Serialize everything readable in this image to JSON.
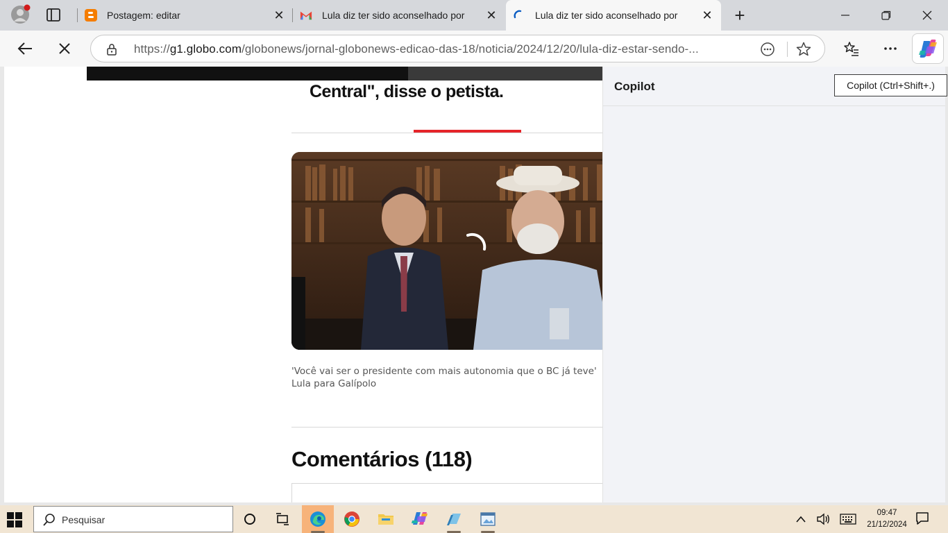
{
  "browser": {
    "tabs": [
      {
        "title": "Postagem: editar",
        "favicon": "blogger-icon",
        "active": false
      },
      {
        "title": "Lula diz ter sido aconselhado por",
        "favicon": "gmail-icon",
        "active": false
      },
      {
        "title": "Lula diz ter sido aconselhado por",
        "favicon": "loading-spinner-icon",
        "active": true
      }
    ],
    "new_tab_symbol": "+",
    "address": {
      "scheme": "https://",
      "host": "g1.globo.com",
      "path": "/globonews/jornal-globonews-edicao-das-18/noticia/2024/12/20/lula-diz-estar-sendo-..."
    }
  },
  "page": {
    "quote_end": "Central\", disse o petista.",
    "video_caption": "'Você vai ser o presidente com mais autonomia que o BC já teve' Lula para Galípolo",
    "comments_title": "Comentários (118)"
  },
  "copilot": {
    "title": "Copilot",
    "tooltip": "Copilot (Ctrl+Shift+.)"
  },
  "taskbar": {
    "search_placeholder": "Pesquisar",
    "time": "09:47",
    "date": "21/12/2024"
  },
  "colors": {
    "accent_red": "#e5242a",
    "taskbar_bg": "#f1e5d3",
    "edge_active_bg": "#f7b37a"
  }
}
